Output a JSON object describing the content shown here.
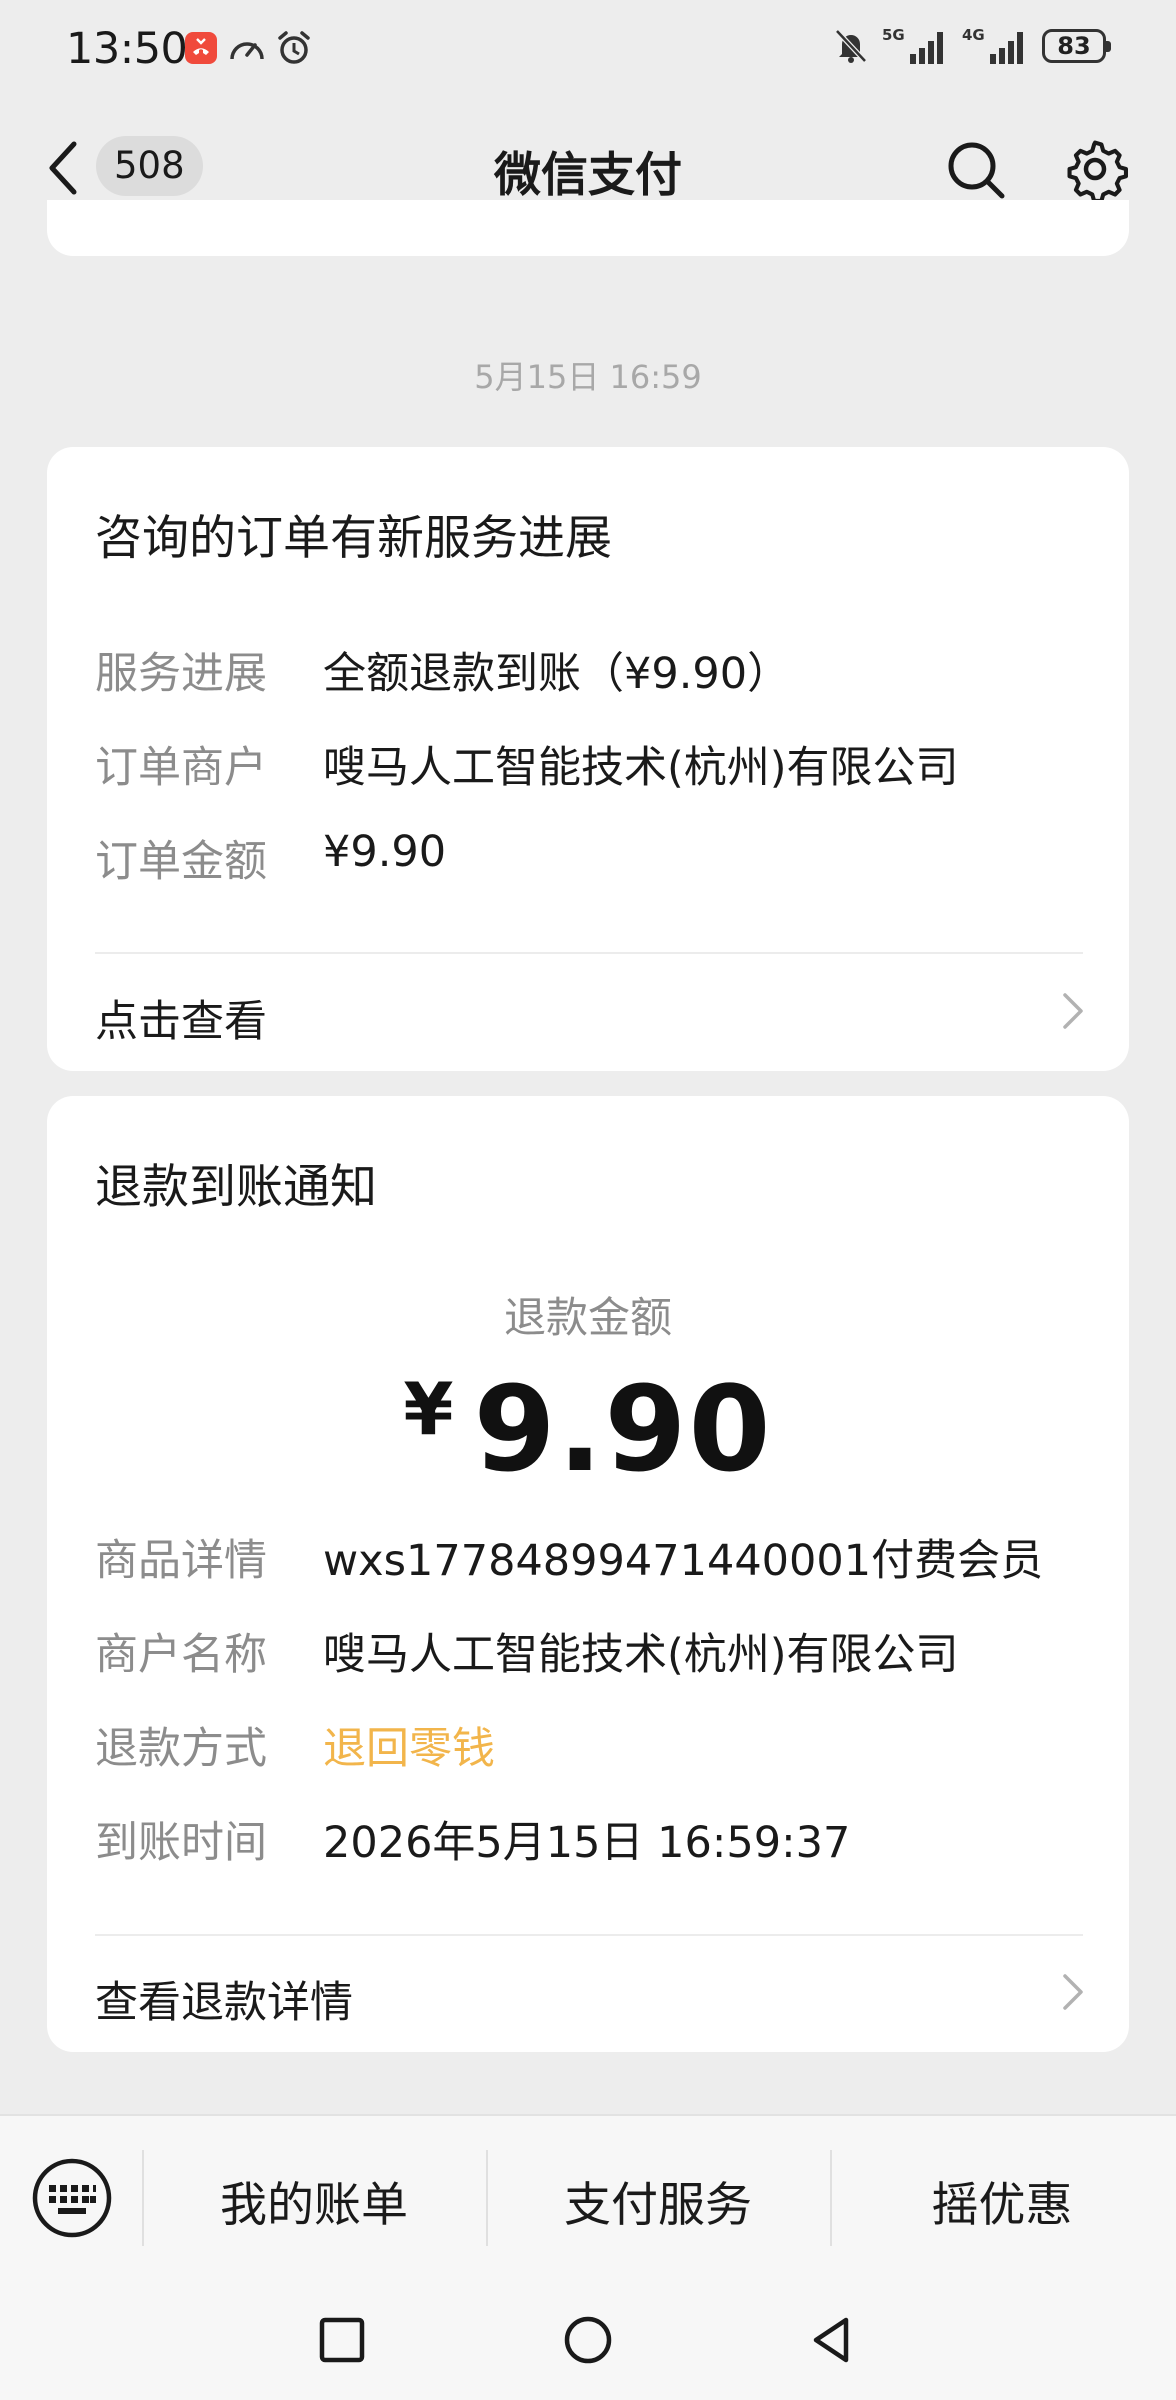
{
  "status_bar": {
    "time": "13:50",
    "battery": "83",
    "net1": "5G",
    "net2": "4G"
  },
  "nav": {
    "back_count": "508",
    "title": "微信支付"
  },
  "timestamp": "5月15日 16:59",
  "card1": {
    "title": "咨询的订单有新服务进展",
    "rows": [
      {
        "label": "服务进展",
        "value": "全额退款到账（¥9.90）"
      },
      {
        "label": "订单商户",
        "value": "嗖马人工智能技术(杭州)有限公司"
      },
      {
        "label": "订单金额",
        "value": "¥9.90"
      }
    ],
    "link": "点击查看"
  },
  "card2": {
    "title": "退款到账通知",
    "amount_label": "退款金额",
    "amount_symbol": "¥",
    "amount": "9.90",
    "rows": [
      {
        "label": "商品详情",
        "value": "wxs1778489947144000​1付费会员"
      },
      {
        "label": "商户名称",
        "value": "嗖马人工智能技术(杭州)有限公司"
      },
      {
        "label": "退款方式",
        "value": "退回零钱"
      },
      {
        "label": "到账时间",
        "value": "2026年5月15日 16:59:37"
      }
    ],
    "link": "查看退款详情"
  },
  "menu": {
    "items": [
      "我的账单",
      "支付服务",
      "摇优惠"
    ]
  },
  "colors": {
    "accent_orange": "#f2b54b",
    "background": "#ededed"
  }
}
